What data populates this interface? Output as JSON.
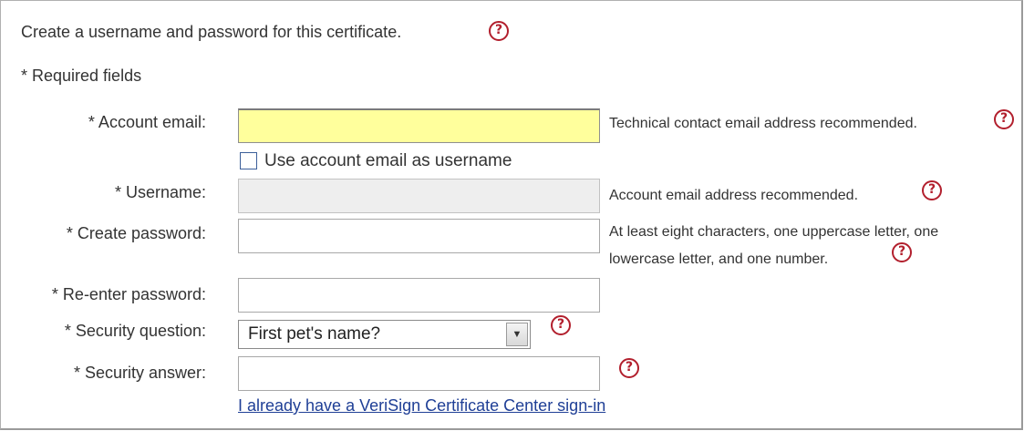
{
  "intro": "Create a username and password for this certificate.",
  "required_note": "* Required fields",
  "account_email": {
    "label": "* Account email:",
    "value": "",
    "hint": "Technical contact email address recommended."
  },
  "use_email_checkbox": {
    "label": "Use account email as username",
    "checked": false
  },
  "username": {
    "label": "* Username:",
    "value": "",
    "hint": "Account email address recommended."
  },
  "create_password": {
    "label": "* Create password:",
    "value": "",
    "hint_line1": "At least eight characters, one uppercase letter, one",
    "hint_line2": "lowercase letter, and one number."
  },
  "reenter_password": {
    "label": "* Re-enter password:",
    "value": ""
  },
  "security_question": {
    "label": "* Security question:",
    "selected": "First pet's name?"
  },
  "security_answer": {
    "label": "* Security answer:",
    "value": ""
  },
  "signin_link": "I already have a VeriSign Certificate Center sign-in",
  "help_glyph": "?",
  "colors": {
    "help_icon": "#b21f2d",
    "highlight_field": "#ffff9c",
    "link": "#1f3f96"
  }
}
